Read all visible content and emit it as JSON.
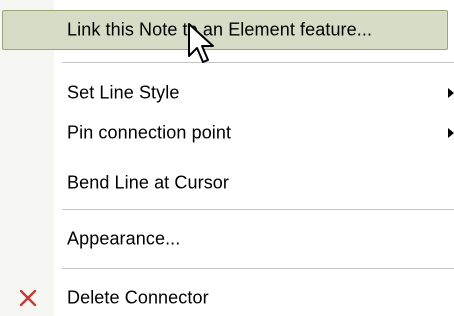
{
  "menu": {
    "items": [
      {
        "label": "Link this Note to an Element feature..."
      },
      {
        "label": "Set Line Style"
      },
      {
        "label": "Pin connection point"
      },
      {
        "label": "Bend Line at Cursor"
      },
      {
        "label": "Appearance..."
      },
      {
        "label": "Delete Connector"
      }
    ]
  },
  "icons": {
    "delete": "close-x-icon",
    "submenu": "submenu-arrow-icon",
    "cursor": "mouse-pointer-icon"
  },
  "colors": {
    "highlight_bg": "#d6dcc6",
    "highlight_border": "#9aa67a",
    "gutter": "#f6f6f2",
    "delete_icon": "#c43a3a"
  }
}
